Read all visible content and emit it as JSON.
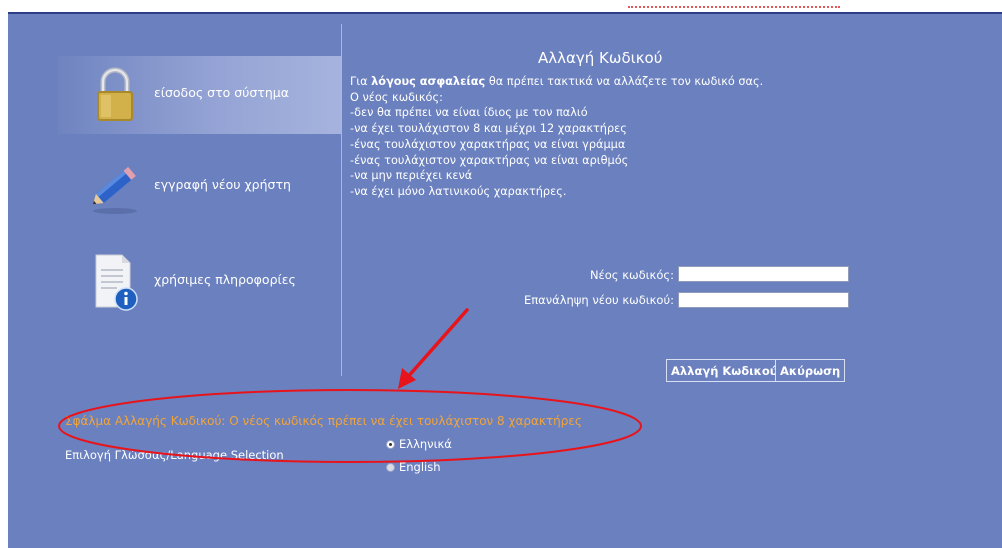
{
  "nav": {
    "items": [
      {
        "label": "είσοδος στο σύστημα",
        "icon": "padlock-icon"
      },
      {
        "label": "εγγραφή νέου χρήστη",
        "icon": "pencil-icon"
      },
      {
        "label": "χρήσιμες πληροφορίες",
        "icon": "document-info-icon"
      }
    ]
  },
  "main": {
    "title": "Αλλαγή Κωδικού",
    "intro_prefix": "Για ",
    "intro_bold": "λόγους ασφαλείας",
    "intro_suffix": " θα πρέπει τακτικά να αλλάζετε τον κωδικό σας.",
    "rules": [
      "Ο νέος κωδικός:",
      "-δεν θα πρέπει να είναι ίδιος με τον παλιό",
      "-να έχει τουλάχιστον 8 και μέχρι 12 χαρακτήρες",
      "-ένας τουλάχιστον χαρακτήρας να είναι γράμμα",
      "-ένας τουλάχιστον χαρακτήρας να είναι αριθμός",
      "-να μην περιέχει κενά",
      "-να έχει μόνο λατινικούς χαρακτήρες."
    ]
  },
  "form": {
    "new_password_label": "Νέος κωδικός:",
    "new_password_value": "",
    "repeat_password_label": "Επανάληψη νέου κωδικού:",
    "repeat_password_value": "",
    "submit_label": "Αλλαγή Κωδικού",
    "cancel_label": "Ακύρωση"
  },
  "error": {
    "message": "Σφάλμα Αλλαγής Κωδικού: Ο νέος κωδικός πρέπει να έχει τουλάχιστον 8 χαρακτήρες"
  },
  "language": {
    "label": "Επιλογή Γλώσσας/Language Selection",
    "options": [
      {
        "label": "Ελληνικά",
        "selected": true
      },
      {
        "label": "English",
        "selected": false
      }
    ]
  },
  "colors": {
    "panel": "#6b80be",
    "error": "#f0a43a",
    "annotation": "#e8141b"
  }
}
